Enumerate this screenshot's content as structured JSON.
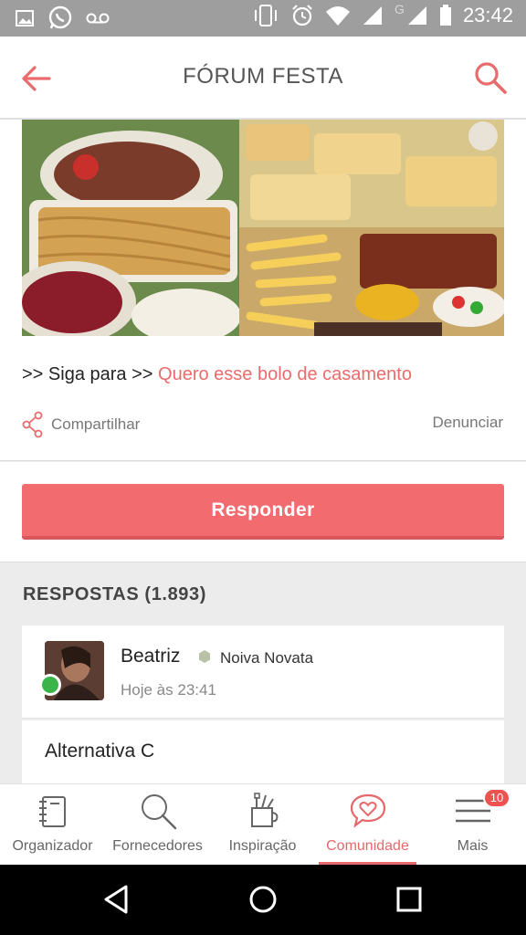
{
  "status_bar": {
    "time": "23:42",
    "network_label": "G",
    "icons": [
      "image-icon",
      "whatsapp-icon",
      "voicemail-icon",
      "vibrate-icon",
      "alarm-icon",
      "wifi-icon",
      "signal-icon",
      "signal-icon",
      "battery-icon"
    ]
  },
  "header": {
    "title": "FÓRUM FESTA",
    "back_icon": "arrow-left-icon",
    "search_icon": "search-icon",
    "accent": "#e96b6b"
  },
  "post": {
    "image_description": "food collage",
    "follow_prefix": ">> Siga para >> ",
    "follow_link": "Quero esse bolo de casamento",
    "share_label": "Compartilhar",
    "report_label": "Denunciar"
  },
  "reply_button": {
    "label": "Responder",
    "color": "#f26c6f"
  },
  "responses": {
    "title": "RESPOSTAS (1.893)",
    "items": [
      {
        "author": "Beatriz",
        "role": "Noiva Novata",
        "time": "Hoje às 23:41",
        "online": true,
        "text": "Alternativa C"
      }
    ]
  },
  "bottom_nav": {
    "items": [
      {
        "label": "Organizador",
        "icon": "notebook-icon",
        "active": false
      },
      {
        "label": "Fornecedores",
        "icon": "search-icon",
        "active": false
      },
      {
        "label": "Inspiração",
        "icon": "craft-cup-icon",
        "active": false
      },
      {
        "label": "Comunidade",
        "icon": "heart-chat-icon",
        "active": true
      },
      {
        "label": "Mais",
        "icon": "menu-icon",
        "active": false,
        "badge": "10"
      }
    ]
  }
}
